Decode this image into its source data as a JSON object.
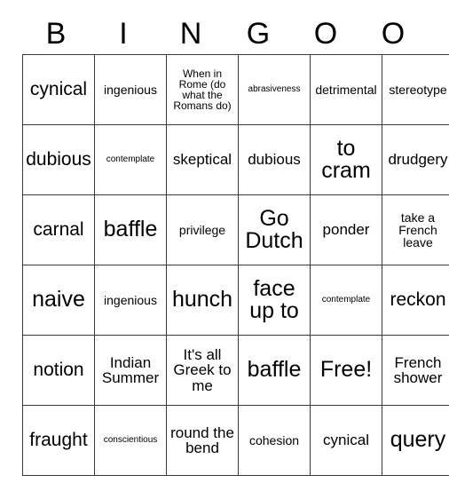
{
  "card": {
    "headers": [
      "B",
      "I",
      "N",
      "G",
      "O",
      "O"
    ],
    "free_space_label": "Free!",
    "rows": [
      [
        {
          "text": "cynical",
          "size": "fs-lg"
        },
        {
          "text": "ingenious",
          "size": "fs-sm"
        },
        {
          "text": "When in Rome (do what the Romans do)",
          "size": "fs-xs"
        },
        {
          "text": "abrasiveness",
          "size": "fs-xxs"
        },
        {
          "text": "detrimental",
          "size": "fs-sm"
        },
        {
          "text": "stereotype",
          "size": "fs-sm"
        }
      ],
      [
        {
          "text": "dubious",
          "size": "fs-lg"
        },
        {
          "text": "contemplate",
          "size": "fs-xxs"
        },
        {
          "text": "skeptical",
          "size": "fs-md"
        },
        {
          "text": "dubious",
          "size": "fs-md"
        },
        {
          "text": "to cram",
          "size": "fs-xl"
        },
        {
          "text": "drudgery",
          "size": "fs-md"
        }
      ],
      [
        {
          "text": "carnal",
          "size": "fs-lg"
        },
        {
          "text": "baffle",
          "size": "fs-xl"
        },
        {
          "text": "privilege",
          "size": "fs-sm"
        },
        {
          "text": "Go Dutch",
          "size": "fs-xl"
        },
        {
          "text": "ponder",
          "size": "fs-md"
        },
        {
          "text": "take a French leave",
          "size": "fs-sm"
        }
      ],
      [
        {
          "text": "naive",
          "size": "fs-xl"
        },
        {
          "text": "ingenious",
          "size": "fs-sm"
        },
        {
          "text": "hunch",
          "size": "fs-xl"
        },
        {
          "text": "face up to",
          "size": "fs-xl"
        },
        {
          "text": "contemplate",
          "size": "fs-xxs"
        },
        {
          "text": "reckon",
          "size": "fs-lg"
        }
      ],
      [
        {
          "text": "notion",
          "size": "fs-lg"
        },
        {
          "text": "Indian Summer",
          "size": "fs-md"
        },
        {
          "text": "It's all Greek to me",
          "size": "fs-md"
        },
        {
          "text": "baffle",
          "size": "fs-xl"
        },
        {
          "text": "Free!",
          "size": "fs-xl"
        },
        {
          "text": "French shower",
          "size": "fs-md"
        }
      ],
      [
        {
          "text": "fraught",
          "size": "fs-lg"
        },
        {
          "text": "conscientious",
          "size": "fs-xxs"
        },
        {
          "text": "round the bend",
          "size": "fs-md"
        },
        {
          "text": "cohesion",
          "size": "fs-sm"
        },
        {
          "text": "cynical",
          "size": "fs-md"
        },
        {
          "text": "query",
          "size": "fs-xl"
        }
      ]
    ]
  },
  "colors": {
    "border": "#3a3a3a",
    "text": "#000000",
    "background": "#ffffff"
  }
}
